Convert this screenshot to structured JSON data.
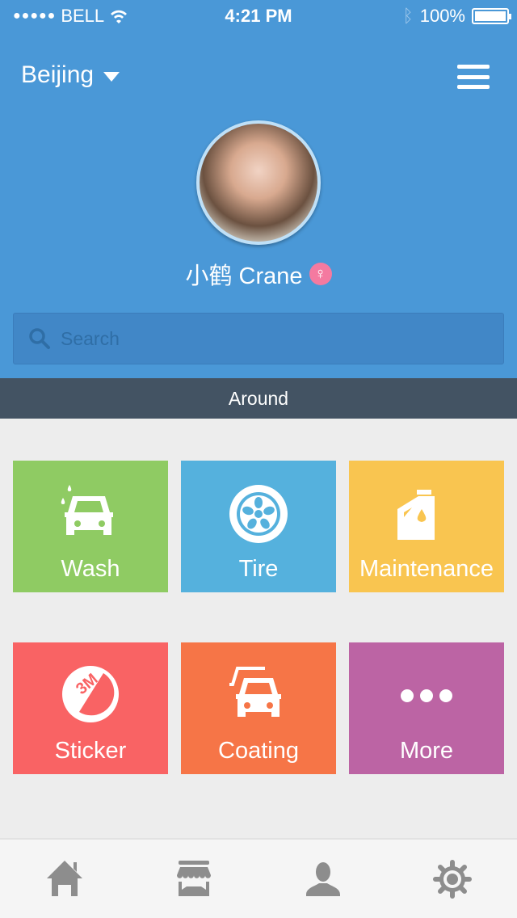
{
  "status_bar": {
    "carrier": "BELL",
    "time": "4:21 PM",
    "battery": "100%"
  },
  "header": {
    "city": "Beijing",
    "user_name": "小鹤 Crane",
    "gender_icon": "female-icon"
  },
  "search": {
    "placeholder": "Search"
  },
  "section": {
    "title": "Around"
  },
  "services": [
    {
      "label": "Wash",
      "color": "#8fcb63",
      "icon": "car-wash-icon"
    },
    {
      "label": "Tire",
      "color": "#55b1dd",
      "icon": "tire-icon"
    },
    {
      "label": "Maintenance",
      "color": "#f9c550",
      "icon": "oil-can-icon"
    },
    {
      "label": "Sticker",
      "color": "#f96364",
      "icon": "sticker-3m-icon"
    },
    {
      "label": "Coating",
      "color": "#f67547",
      "icon": "car-coating-icon"
    },
    {
      "label": "More",
      "color": "#bc64a4",
      "icon": "more-icon"
    }
  ],
  "tabbar": [
    {
      "icon": "home-icon"
    },
    {
      "icon": "store-icon"
    },
    {
      "icon": "user-icon"
    },
    {
      "icon": "gear-icon"
    }
  ]
}
